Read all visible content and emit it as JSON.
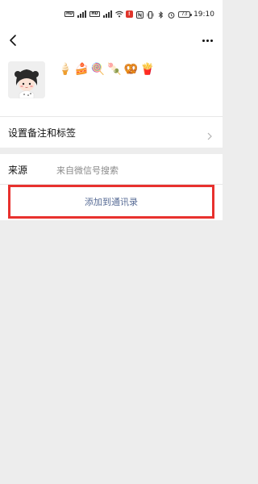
{
  "status_bar": {
    "network_left": "HD",
    "network_right": "HD",
    "clock": "19:10",
    "battery": "73",
    "notification_icon": "app-notification-icon"
  },
  "nav": {
    "back_icon": "back-chevron-icon",
    "more_icon": "more-dots-icon"
  },
  "profile": {
    "avatar": "cartoon-girl-avatar",
    "nickname_emojis": [
      "🍦",
      "🍰",
      "🍭",
      "🍡",
      "🥨",
      "🍟"
    ]
  },
  "remark_row": {
    "label": "设置备注和标签"
  },
  "source_row": {
    "label": "来源",
    "value": "来自微信号搜索"
  },
  "add_button": {
    "label": "添加到通讯录",
    "link_color": "#576b95",
    "highlight_color": "#e8312e"
  }
}
